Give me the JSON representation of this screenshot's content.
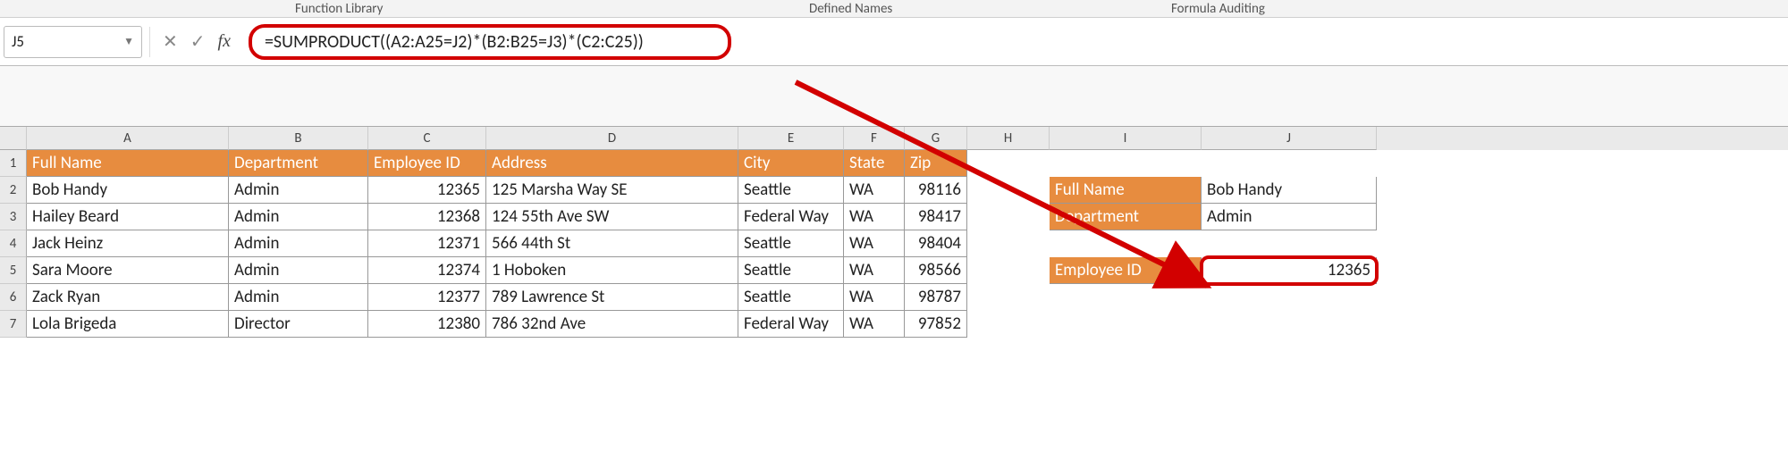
{
  "ribbon": {
    "function_library": "Function Library",
    "defined_names": "Defined Names",
    "formula_auditing": "Formula Auditing"
  },
  "formula_bar": {
    "name_box": "J5",
    "cancel_icon": "✕",
    "enter_icon": "✓",
    "fx_label": "fx",
    "formula": "=SUMPRODUCT((A2:A25=J2)*(B2:B25=J3)*(C2:C25))"
  },
  "columns": [
    "A",
    "B",
    "C",
    "D",
    "E",
    "F",
    "G",
    "H",
    "I",
    "J"
  ],
  "row_numbers": [
    "1",
    "2",
    "3",
    "4",
    "5",
    "6",
    "7"
  ],
  "headers": {
    "full_name": "Full Name",
    "department": "Department",
    "employee_id": "Employee ID",
    "address": "Address",
    "city": "City",
    "state": "State",
    "zip": "Zip"
  },
  "data": [
    {
      "full_name": "Bob Handy",
      "department": "Admin",
      "employee_id": "12365",
      "address": "125 Marsha Way SE",
      "city": "Seattle",
      "state": "WA",
      "zip": "98116"
    },
    {
      "full_name": "Hailey Beard",
      "department": "Admin",
      "employee_id": "12368",
      "address": "124 55th Ave SW",
      "city": "Federal Way",
      "state": "WA",
      "zip": "98417"
    },
    {
      "full_name": "Jack Heinz",
      "department": "Admin",
      "employee_id": "12371",
      "address": "566 44th St",
      "city": "Seattle",
      "state": "WA",
      "zip": "98404"
    },
    {
      "full_name": "Sara Moore",
      "department": "Admin",
      "employee_id": "12374",
      "address": "1 Hoboken",
      "city": "Seattle",
      "state": "WA",
      "zip": "98566"
    },
    {
      "full_name": "Zack Ryan",
      "department": "Admin",
      "employee_id": "12377",
      "address": "789 Lawrence St",
      "city": "Seattle",
      "state": "WA",
      "zip": "98787"
    },
    {
      "full_name": "Lola Brigeda",
      "department": "Director",
      "employee_id": "12380",
      "address": "786 32nd Ave",
      "city": "Federal Way",
      "state": "WA",
      "zip": "97852"
    }
  ],
  "lookup": {
    "full_name_label": "Full Name",
    "full_name_value": "Bob Handy",
    "department_label": "Department",
    "department_value": "Admin",
    "employee_id_label": "Employee ID",
    "employee_id_value": "12365"
  }
}
